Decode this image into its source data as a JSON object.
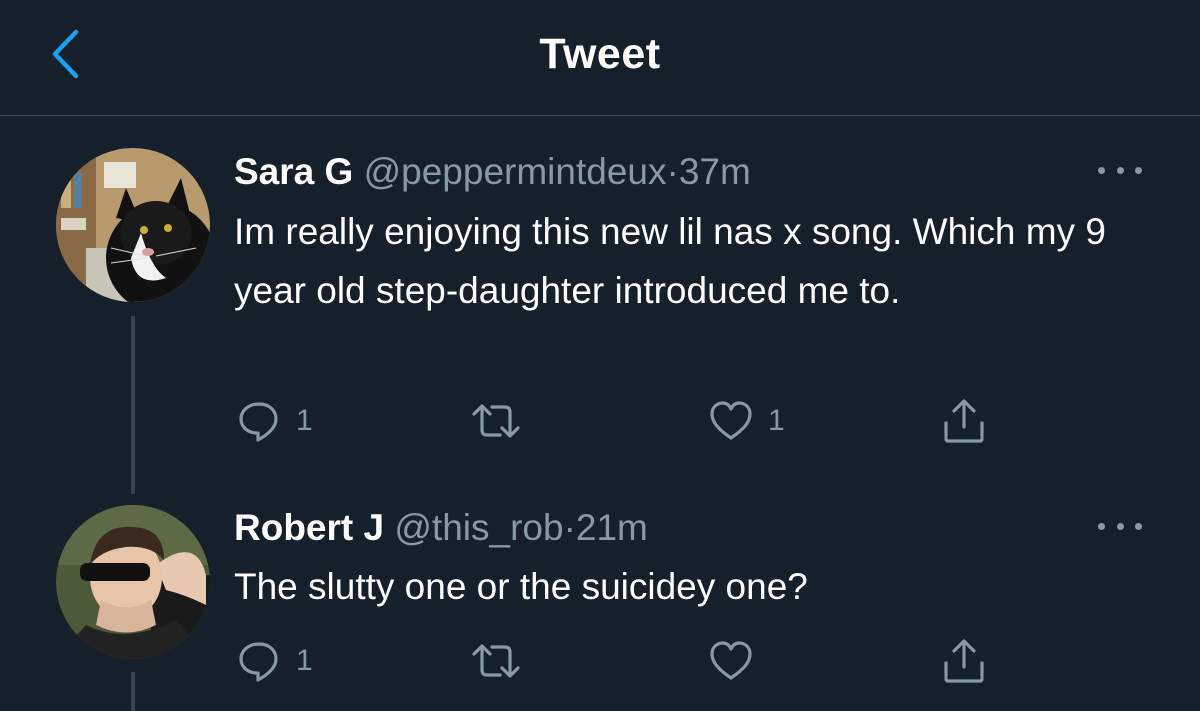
{
  "header": {
    "title": "Tweet",
    "back_icon": "chevron-left-icon"
  },
  "colors": {
    "background": "#15202b",
    "accent": "#1da1f2",
    "muted": "#8899a6",
    "divider": "#38444d"
  },
  "tweets": [
    {
      "name": "Sara G",
      "handle": "@peppermintdeux",
      "separator": "·",
      "time": "37m",
      "text": "Im really enjoying this new lil nas x song. Which my 9 year old step-daughter introduced me to.",
      "avatar": "cat-avatar",
      "actions": {
        "reply_count": "1",
        "retweet_count": "",
        "like_count": "1"
      }
    },
    {
      "name": "Robert J",
      "handle": "@this_rob",
      "separator": "·",
      "time": "21m",
      "text": "The slutty one or the suicidey one?",
      "avatar": "person-avatar",
      "actions": {
        "reply_count": "1",
        "retweet_count": "",
        "like_count": ""
      }
    }
  ]
}
